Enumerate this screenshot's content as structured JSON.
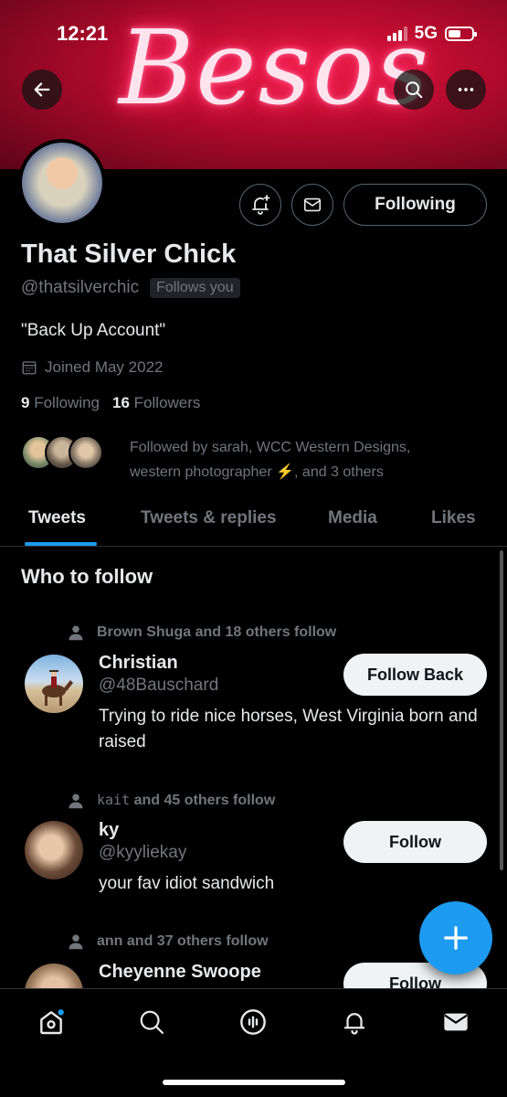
{
  "status_bar": {
    "time": "12:21",
    "network": "5G"
  },
  "banner": {
    "text": "Besos"
  },
  "profile": {
    "name": "That Silver Chick",
    "handle": "@thatsilverchic",
    "follows_you": "Follows you",
    "bio": "\"Back Up Account\"",
    "joined": "Joined May 2022",
    "following_count": "9",
    "following_label": "Following",
    "followers_count": "16",
    "followers_label": "Followers",
    "followed_by_line1": "Followed by sarah, WCC Western Designs,",
    "followed_by_line2": "western photographer ⚡️, and 3 others"
  },
  "buttons": {
    "following": "Following"
  },
  "tabs": [
    {
      "label": "Tweets",
      "active": true
    },
    {
      "label": "Tweets & replies",
      "active": false
    },
    {
      "label": "Media",
      "active": false
    },
    {
      "label": "Likes",
      "active": false
    }
  ],
  "who_to_follow": {
    "title": "Who to follow",
    "users": [
      {
        "social_name": "Brown Shuga",
        "social_rest": "and 18 others follow",
        "name": "Christian",
        "handle": "@48Bauschard",
        "bio": "Trying to ride nice horses, West Virginia born and raised",
        "button": "Follow Back"
      },
      {
        "social_name": "kait",
        "social_rest": "and 45 others follow",
        "name": "ky",
        "handle": "@kyyliekay",
        "bio": "your fav idiot sandwich",
        "button": "Follow"
      },
      {
        "social_name": "ann",
        "social_rest": "and 37 others follow",
        "name": "Cheyenne Swoope",
        "handle": "",
        "bio": "",
        "button": "Follow"
      }
    ]
  },
  "colors": {
    "accent": "#1d9bf0",
    "banner": "#d4113a",
    "muted": "#71767b"
  }
}
